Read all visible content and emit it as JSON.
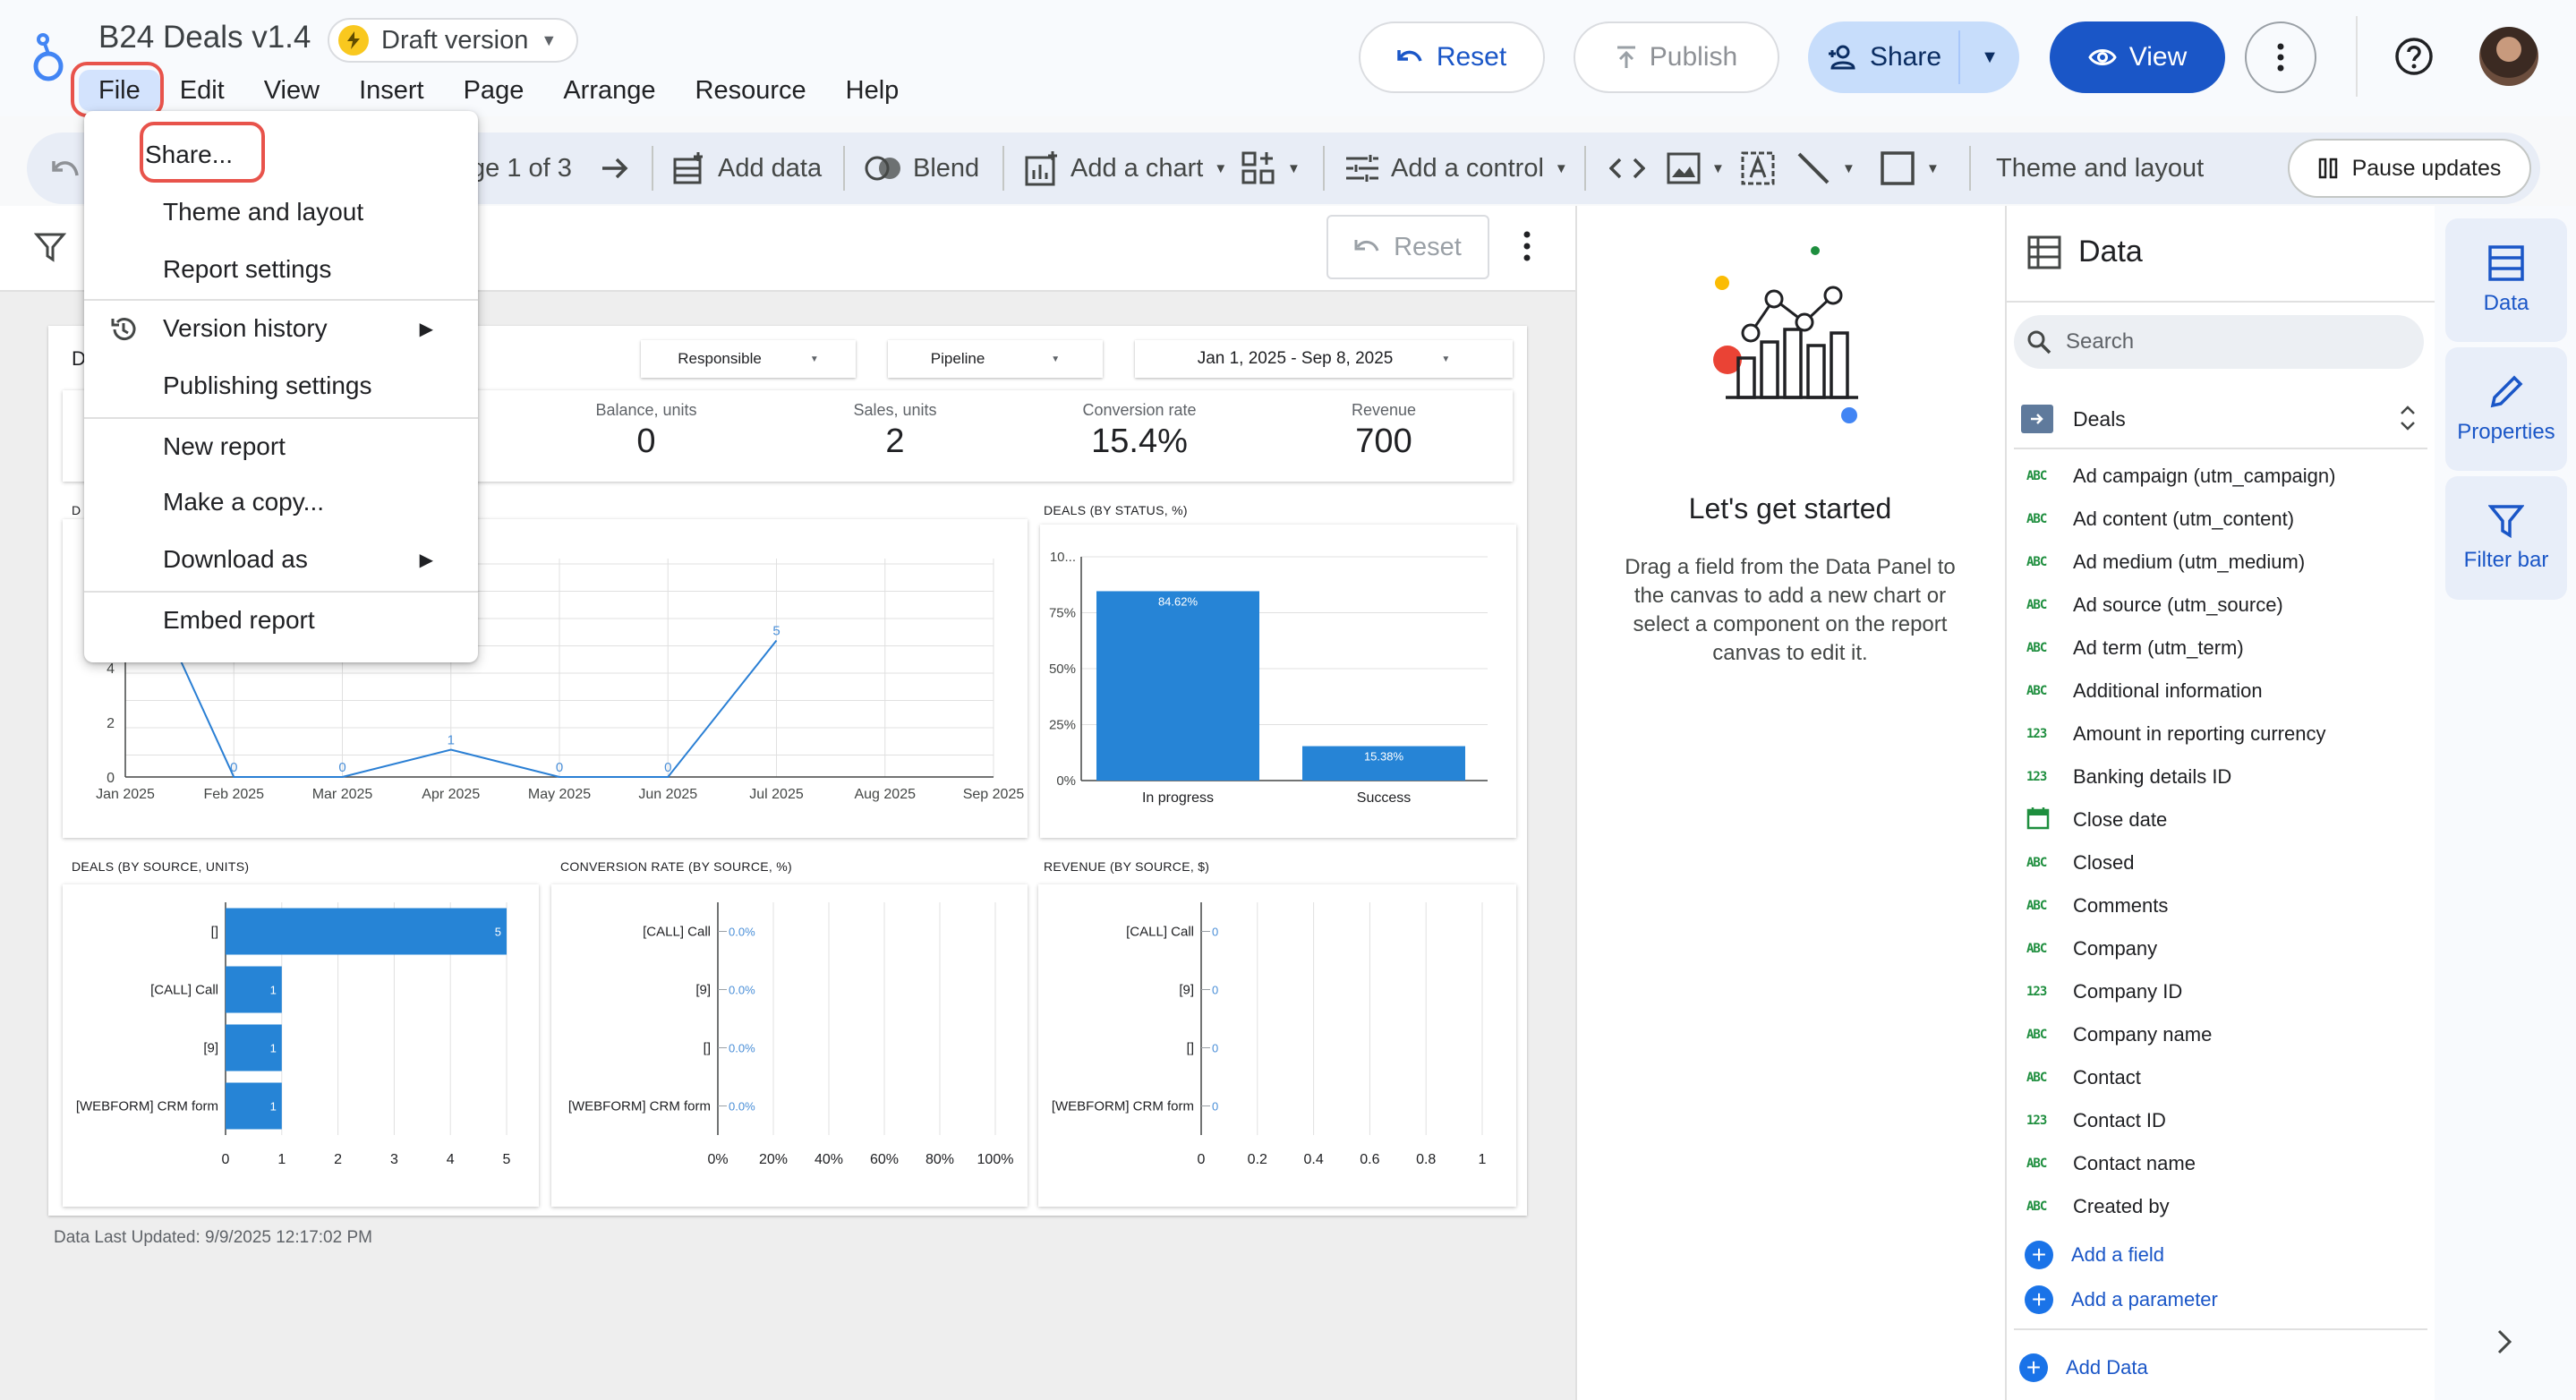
{
  "header": {
    "title": "B24 Deals v1.4",
    "draft_label": "Draft version",
    "menu": [
      "File",
      "Edit",
      "View",
      "Insert",
      "Page",
      "Arrange",
      "Resource",
      "Help"
    ],
    "reset_label": "Reset",
    "publish_label": "Publish",
    "share_label": "Share",
    "view_label": "View"
  },
  "toolbar": {
    "page_label": "ge 1 of 3",
    "add_data": "Add data",
    "blend": "Blend",
    "add_chart": "Add a chart",
    "add_control": "Add a control",
    "theme_layout": "Theme and layout",
    "pause_updates": "Pause updates"
  },
  "file_menu": {
    "share": "Share...",
    "theme_layout": "Theme and layout",
    "report_settings": "Report settings",
    "version_history": "Version history",
    "publishing_settings": "Publishing settings",
    "new_report": "New report",
    "make_copy": "Make a copy...",
    "download_as": "Download as",
    "embed_report": "Embed report"
  },
  "canvas": {
    "reset_label": "Reset",
    "report_fragment": "D",
    "controls": [
      "Responsible",
      "Pipeline",
      "Jan 1, 2025 - Sep 8, 2025"
    ],
    "kpis": [
      {
        "label": "Balance, units",
        "value": "0"
      },
      {
        "label": "Sales, units",
        "value": "2"
      },
      {
        "label": "Conversion rate",
        "value": "15.4%"
      },
      {
        "label": "Revenue",
        "value": "700"
      }
    ],
    "updated": "Data Last Updated: 9/9/2025 12:17:02 PM"
  },
  "chart_data": [
    {
      "type": "line",
      "title": "D",
      "x": [
        "Jan 2025",
        "Feb 2025",
        "Mar 2025",
        "Apr 2025",
        "May 2025",
        "Jun 2025",
        "Jul 2025",
        "Aug 2025",
        "Sep 2025"
      ],
      "values": [
        null,
        0,
        0,
        1,
        0,
        0,
        5,
        null,
        null
      ],
      "y_ticks": [
        "0",
        "2",
        "4"
      ],
      "ylim": [
        0,
        8
      ]
    },
    {
      "type": "bar",
      "title": "DEALS (BY STATUS, %)",
      "categories": [
        "In progress",
        "Success"
      ],
      "values": [
        84.62,
        15.38
      ],
      "data_labels": [
        "84.62%",
        "15.38%"
      ],
      "y_ticks": [
        "0%",
        "25%",
        "50%",
        "75%",
        "10..."
      ],
      "ylim": [
        0,
        100
      ]
    },
    {
      "type": "bar",
      "orientation": "horizontal",
      "title": "DEALS (BY SOURCE, UNITS)",
      "categories": [
        "[]",
        "[CALL] Call",
        "[9]",
        "[WEBFORM] CRM form"
      ],
      "values": [
        5,
        1,
        1,
        1
      ],
      "x_ticks": [
        "0",
        "1",
        "2",
        "3",
        "4",
        "5"
      ],
      "xlim": [
        0,
        5
      ]
    },
    {
      "type": "bar",
      "orientation": "horizontal",
      "title": "CONVERSION RATE (BY SOURCE, %)",
      "categories": [
        "[CALL] Call",
        "[9]",
        "[]",
        "[WEBFORM] CRM form"
      ],
      "values": [
        0,
        0,
        0,
        0
      ],
      "data_labels": [
        "0.0%",
        "0.0%",
        "0.0%",
        "0.0%"
      ],
      "x_ticks": [
        "0%",
        "20%",
        "40%",
        "60%",
        "80%",
        "100%"
      ],
      "xlim": [
        0,
        100
      ]
    },
    {
      "type": "bar",
      "orientation": "horizontal",
      "title": "REVENUE (BY SOURCE, $)",
      "categories": [
        "[CALL] Call",
        "[9]",
        "[]",
        "[WEBFORM] CRM form"
      ],
      "values": [
        0,
        0,
        0,
        0
      ],
      "data_labels": [
        "0",
        "0",
        "0",
        "0"
      ],
      "x_ticks": [
        "0",
        "0.2",
        "0.4",
        "0.6",
        "0.8",
        "1"
      ],
      "xlim": [
        0,
        1
      ]
    }
  ],
  "getting_started": {
    "title": "Let's get started",
    "text": "Drag a field from the Data Panel to the canvas to add a new chart or select a component on the report canvas to edit it."
  },
  "data_panel": {
    "title": "Data",
    "search_placeholder": "Search",
    "source": "Deals",
    "fields": [
      {
        "type": "ABC",
        "name": "Ad campaign (utm_campaign)"
      },
      {
        "type": "ABC",
        "name": "Ad content (utm_content)"
      },
      {
        "type": "ABC",
        "name": "Ad medium (utm_medium)"
      },
      {
        "type": "ABC",
        "name": "Ad source (utm_source)"
      },
      {
        "type": "ABC",
        "name": "Ad term (utm_term)"
      },
      {
        "type": "ABC",
        "name": "Additional information"
      },
      {
        "type": "123",
        "name": "Amount in reporting currency"
      },
      {
        "type": "123",
        "name": "Banking details ID"
      },
      {
        "type": "date",
        "name": "Close date"
      },
      {
        "type": "ABC",
        "name": "Closed"
      },
      {
        "type": "ABC",
        "name": "Comments"
      },
      {
        "type": "ABC",
        "name": "Company"
      },
      {
        "type": "123",
        "name": "Company ID"
      },
      {
        "type": "ABC",
        "name": "Company name"
      },
      {
        "type": "ABC",
        "name": "Contact"
      },
      {
        "type": "123",
        "name": "Contact ID"
      },
      {
        "type": "ABC",
        "name": "Contact name"
      },
      {
        "type": "ABC",
        "name": "Created by"
      }
    ],
    "add_field": "Add a field",
    "add_parameter": "Add a parameter",
    "add_data": "Add Data"
  },
  "rail": {
    "data": "Data",
    "properties": "Properties",
    "filter_bar": "Filter bar"
  },
  "colors": {
    "accent": "#1a56c7",
    "bar": "#2684d6",
    "highlight": "#e8534b"
  }
}
